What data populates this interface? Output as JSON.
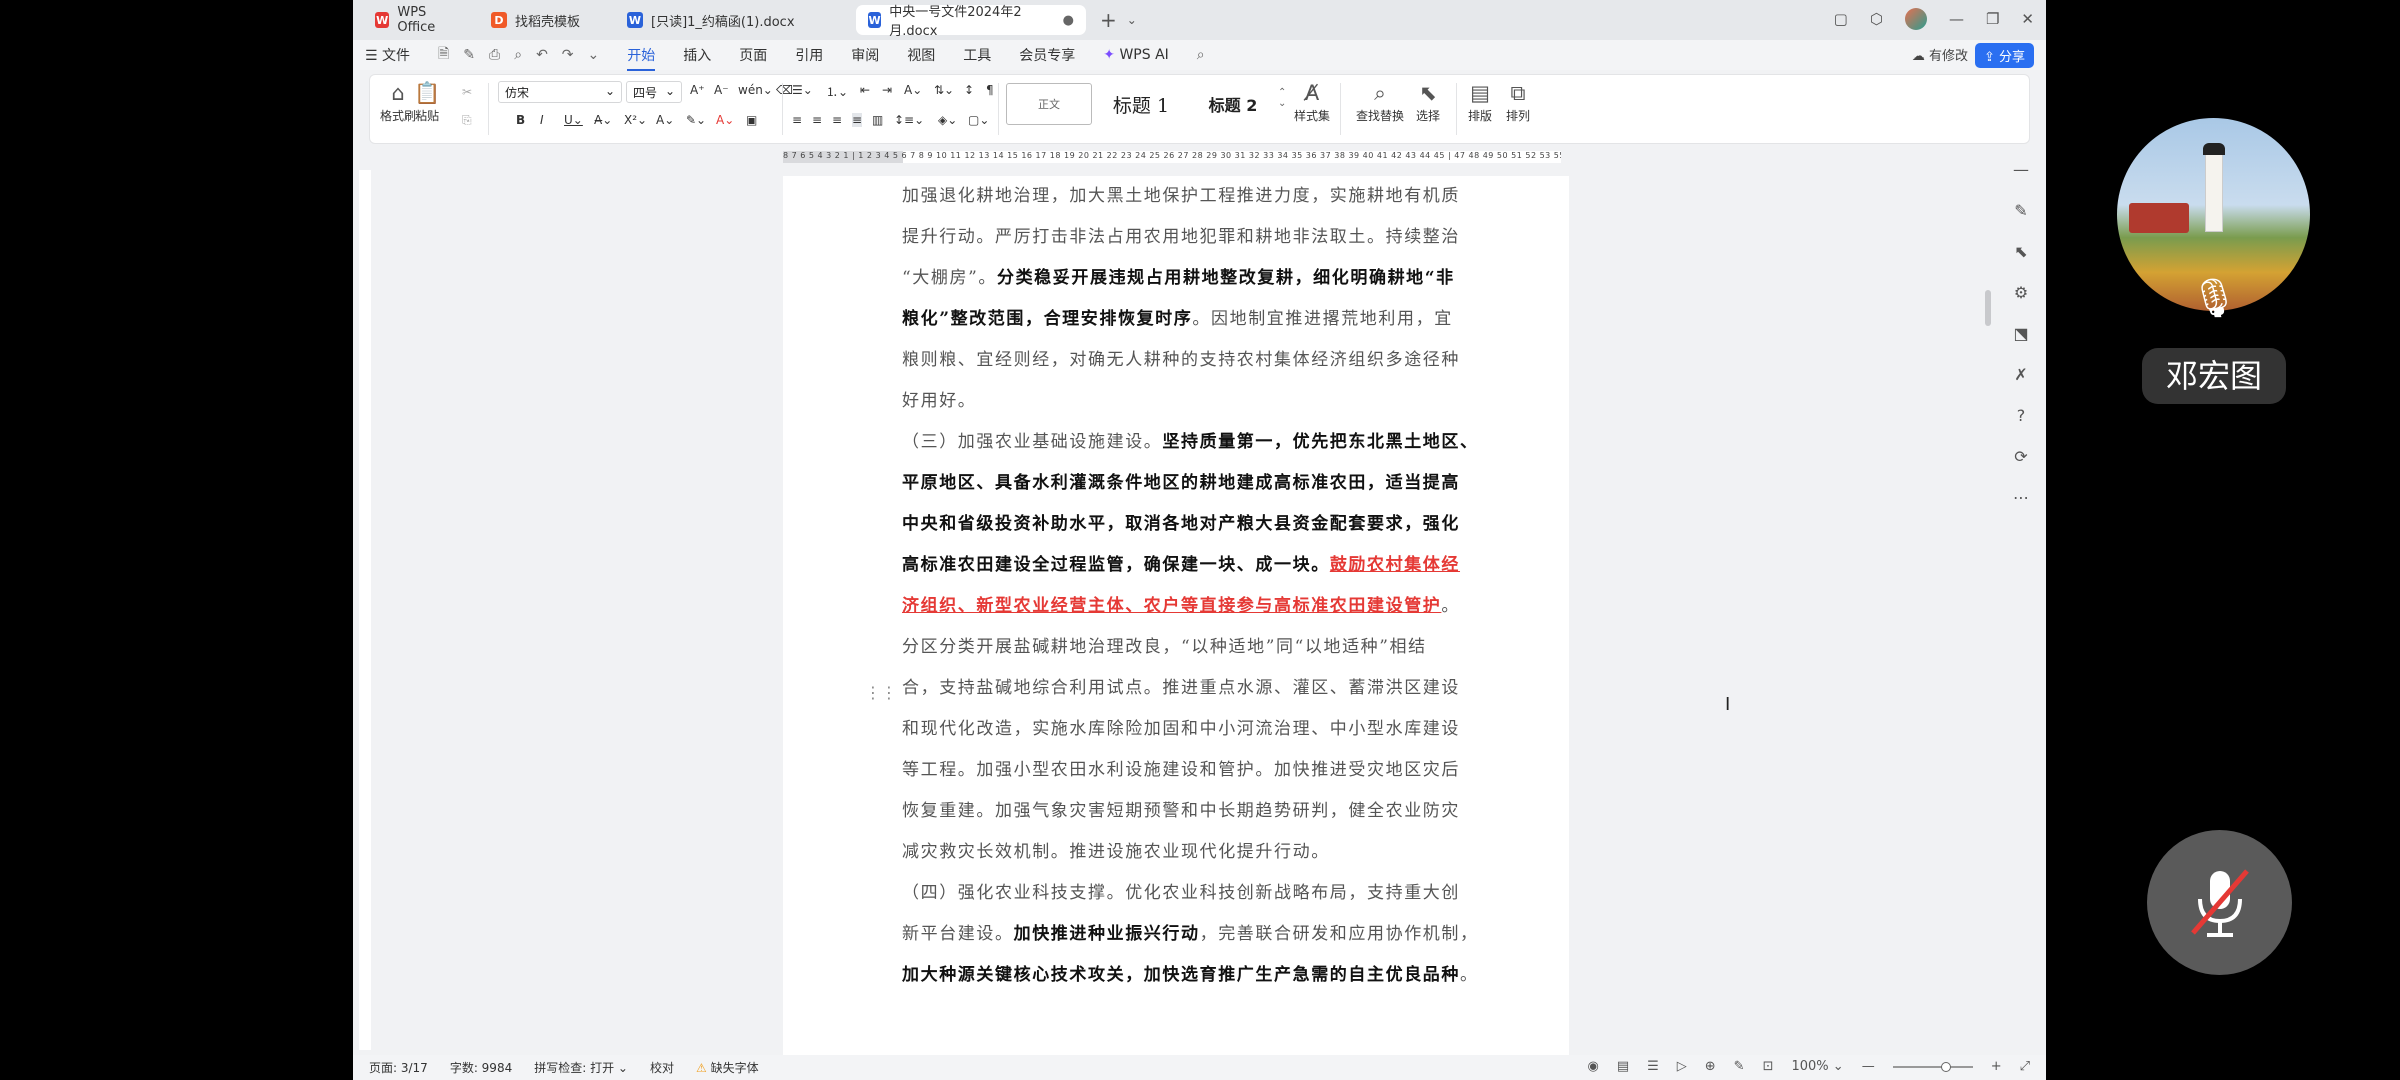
{
  "tabs": [
    {
      "label": "WPS Office",
      "icon": "W"
    },
    {
      "label": "找稻壳模板",
      "icon": "D"
    },
    {
      "label": "[只读]1_约稿函(1).docx",
      "icon": "W"
    },
    {
      "label": "中央一号文件2024年2月.docx",
      "icon": "W"
    }
  ],
  "menu": {
    "file": "文件",
    "items": [
      "开始",
      "插入",
      "页面",
      "引用",
      "审阅",
      "视图",
      "工具",
      "会员专享"
    ],
    "wps_ai": "WPS AI",
    "modify": "有修改",
    "share": "分享"
  },
  "ribbon": {
    "format_painter": "格式刷",
    "paste": "粘贴",
    "font": "仿宋",
    "size": "四号",
    "style_normal": "正文",
    "style_h1": "标题 1",
    "style_h2": "标题 2",
    "style_set": "样式集",
    "find_replace": "查找替换",
    "select": "选择",
    "layout": "排版",
    "arrange": "排列"
  },
  "ruler": "8 7 6 5 4 3 2 1 | 1 2 3 4 5 6 7 8 9 10 11 12 13 14 15 16 17 18 19 20 21 22 23 24 25 26 27 28 29 30 31 32 33 34 35 36 37 38 39 40 41 42 43 44 45 | 47 48 49 50 51 52 53 55",
  "doc": {
    "l1": "加强退化耕地治理，加大黑土地保护工程推进力度，实施耕地有机质",
    "l2": "提升行动。严厉打击非法占用农用地犯罪和耕地非法取土。持续整治",
    "l3a": "“大棚房”。",
    "l3b": "分类稳妥开展违规占用耕地整改复耕，细化明确耕地“非",
    "l4a": "粮化”整改范围，合理安排恢复时序",
    "l4b": "。因地制宜推进撂荒地利用，宜",
    "l5": "粮则粮、宜经则经，对确无人耕种的支持农村集体经济组织多途径种",
    "l6": "好用好。",
    "l7a": "（三）加强农业基础设施建设。",
    "l7b": "坚持质量第一，优先把东北黑土地区、",
    "l8": "平原地区、具备水利灌溉条件地区的耕地建成高标准农田，适当提高",
    "l9": "中央和省级投资补助水平，取消各地对产粮大县资金配套要求，强化",
    "l10a": "高标准农田建设全过程监管，确保建一块、成一块。",
    "l10b": "鼓励农村集体经",
    "l11a": "济组织、新型农业经营主体、农户等直接参与高标准农田建设管护",
    "l11b": "。",
    "l12": "分区分类开展盐碱耕地治理改良，“以种适地”同“以地适种”相结",
    "l13": "合，支持盐碱地综合利用试点。推进重点水源、灌区、蓄滞洪区建设",
    "l14": "和现代化改造，实施水库除险加固和中小河流治理、中小型水库建设",
    "l15": "等工程。加强小型农田水利设施建设和管护。加快推进受灾地区灾后",
    "l16": "恢复重建。加强气象灾害短期预警和中长期趋势研判，健全农业防灾",
    "l17": "减灾救灾长效机制。推进设施农业现代化提升行动。",
    "l18": "（四）强化农业科技支撑。优化农业科技创新战略布局，支持重大创",
    "l19a": "新平台建设。",
    "l19b": "加快推进种业振兴行动",
    "l19c": "，完善联合研发和应用协作机制，",
    "l20a": "加大种源关键核心技术攻关，加快选育推广生产急需的自主优良品种",
    "l20b": "。"
  },
  "status": {
    "page": "页面: 3/17",
    "words": "字数: 9984",
    "spell": "拼写检查: 打开",
    "proof": "校对",
    "missing_font": "缺失字体",
    "zoom": "100%"
  },
  "overlay": {
    "name": "邓宏图"
  },
  "colors": {
    "accent": "#2a62d9",
    "red": "#e53935",
    "share": "#2a6ff1"
  }
}
